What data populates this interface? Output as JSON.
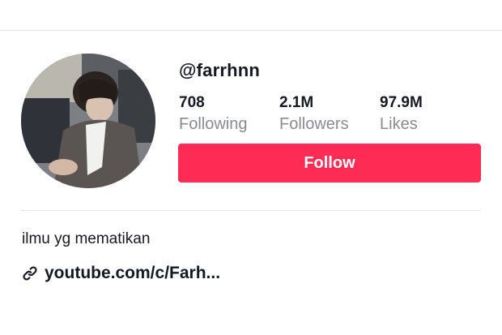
{
  "profile": {
    "username": "@farrhnn",
    "bio": "ilmu yg mematikan",
    "link": "youtube.com/c/Farh..."
  },
  "stats": [
    {
      "value": "708",
      "label": "Following"
    },
    {
      "value": "2.1M",
      "label": "Followers"
    },
    {
      "value": "97.9M",
      "label": "Likes"
    }
  ],
  "actions": {
    "follow_label": "Follow"
  },
  "icons": {
    "link": "link-icon"
  },
  "colors": {
    "follow_button": "#fe2c55",
    "label_gray": "#8a8b91",
    "text": "#161823"
  }
}
